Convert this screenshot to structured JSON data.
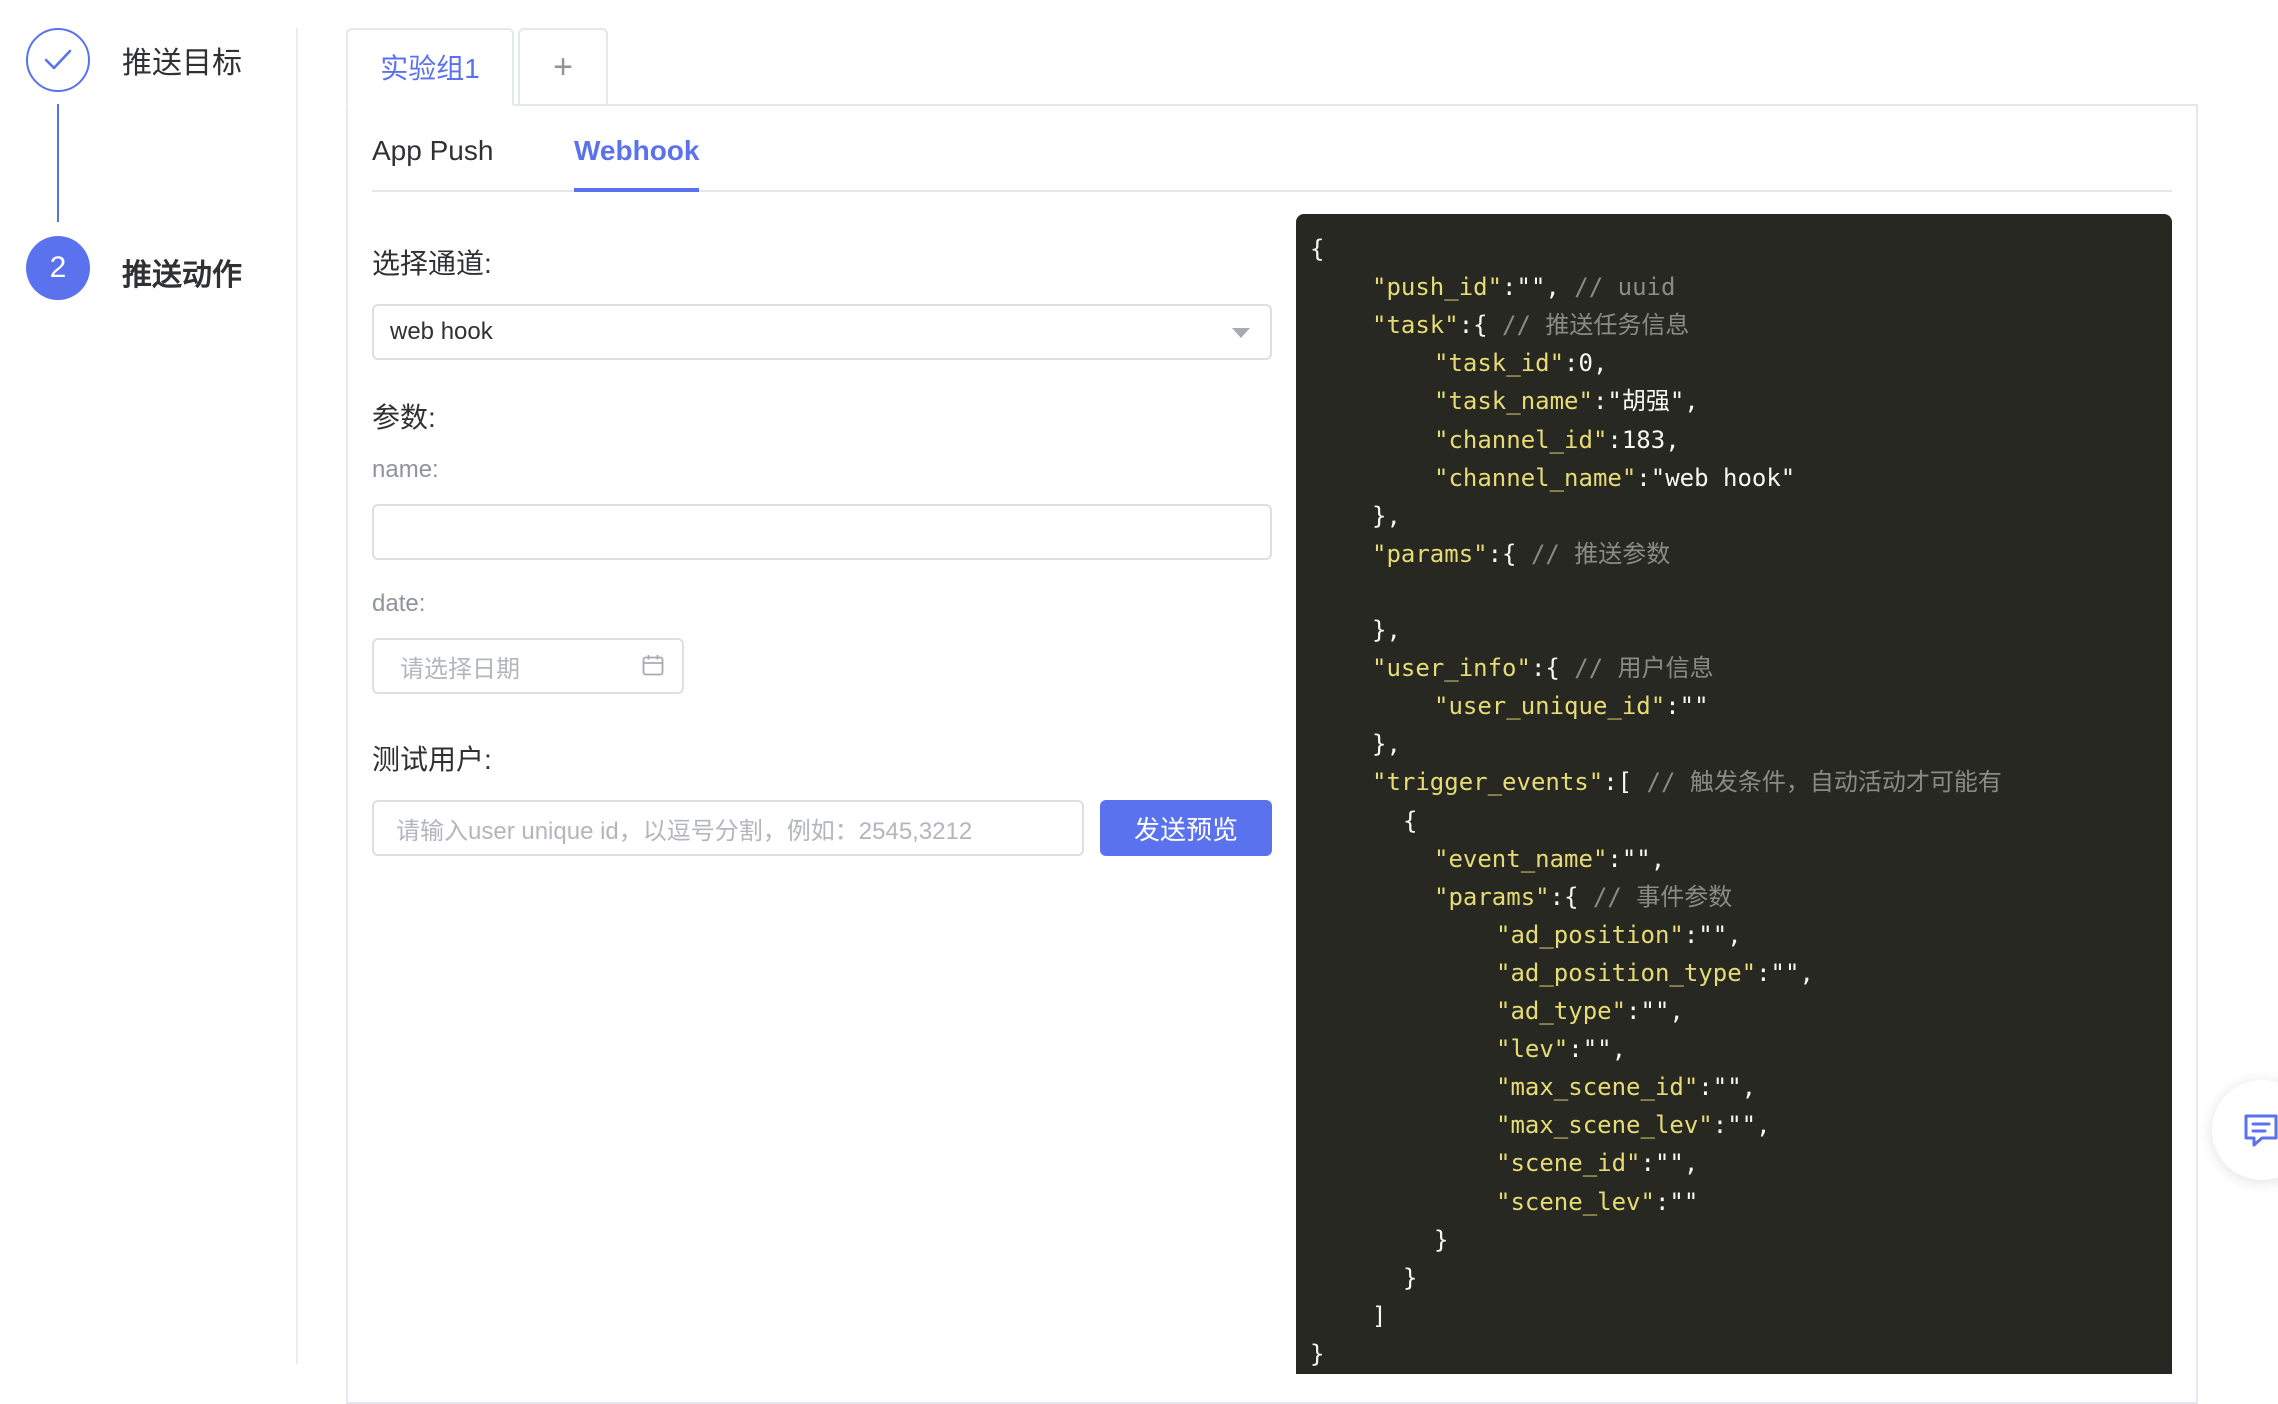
{
  "steps": [
    {
      "label": "推送目标",
      "status": "done"
    },
    {
      "number": "2",
      "label": "推送动作",
      "status": "active"
    }
  ],
  "group_tabs": [
    {
      "label": "实验组1",
      "active": true
    },
    {
      "label": "+",
      "active": false
    }
  ],
  "sub_tabs": [
    {
      "label": "App Push",
      "active": false
    },
    {
      "label": "Webhook",
      "active": true
    }
  ],
  "form": {
    "channel_label": "选择通道:",
    "channel_value": "web hook",
    "params_label": "参数:",
    "name_label": "name:",
    "name_value": "",
    "date_label": "date:",
    "date_placeholder": "请选择日期",
    "test_user_label": "测试用户:",
    "test_user_placeholder": "请输入user unique id，以逗号分割，例如：2545,3212",
    "send_button": "发送预览"
  },
  "code": {
    "lines": [
      {
        "indent": 0,
        "key": "",
        "value": "{",
        "comment": ""
      },
      {
        "indent": 1,
        "key": "\"push_id\"",
        "value": ":\"\",",
        "comment": " // uuid"
      },
      {
        "indent": 1,
        "key": "\"task\"",
        "value": ":{",
        "comment": " // 推送任务信息"
      },
      {
        "indent": 2,
        "key": "\"task_id\"",
        "value": ":0,",
        "comment": ""
      },
      {
        "indent": 2,
        "key": "\"task_name\"",
        "value": ":\"胡强\",",
        "comment": ""
      },
      {
        "indent": 2,
        "key": "\"channel_id\"",
        "value": ":183,",
        "comment": ""
      },
      {
        "indent": 2,
        "key": "\"channel_name\"",
        "value": ":\"web hook\"",
        "comment": ""
      },
      {
        "indent": 1,
        "key": "",
        "value": "},",
        "comment": ""
      },
      {
        "indent": 1,
        "key": "\"params\"",
        "value": ":{",
        "comment": " // 推送参数"
      },
      {
        "indent": 0,
        "key": "",
        "value": "",
        "comment": ""
      },
      {
        "indent": 1,
        "key": "",
        "value": "},",
        "comment": ""
      },
      {
        "indent": 1,
        "key": "\"user_info\"",
        "value": ":{",
        "comment": " // 用户信息"
      },
      {
        "indent": 2,
        "key": "\"user_unique_id\"",
        "value": ":\"\"",
        "comment": ""
      },
      {
        "indent": 1,
        "key": "",
        "value": "},",
        "comment": ""
      },
      {
        "indent": 1,
        "key": "\"trigger_events\"",
        "value": ":[",
        "comment": " // 触发条件，自动活动才可能有"
      },
      {
        "indent": 1.5,
        "key": "",
        "value": "{",
        "comment": ""
      },
      {
        "indent": 2,
        "key": "\"event_name\"",
        "value": ":\"\",",
        "comment": ""
      },
      {
        "indent": 2,
        "key": "\"params\"",
        "value": ":{",
        "comment": " // 事件参数"
      },
      {
        "indent": 3,
        "key": "\"ad_position\"",
        "value": ":\"\",",
        "comment": ""
      },
      {
        "indent": 3,
        "key": "\"ad_position_type\"",
        "value": ":\"\",",
        "comment": ""
      },
      {
        "indent": 3,
        "key": "\"ad_type\"",
        "value": ":\"\",",
        "comment": ""
      },
      {
        "indent": 3,
        "key": "\"lev\"",
        "value": ":\"\",",
        "comment": ""
      },
      {
        "indent": 3,
        "key": "\"max_scene_id\"",
        "value": ":\"\",",
        "comment": ""
      },
      {
        "indent": 3,
        "key": "\"max_scene_lev\"",
        "value": ":\"\",",
        "comment": ""
      },
      {
        "indent": 3,
        "key": "\"scene_id\"",
        "value": ":\"\",",
        "comment": ""
      },
      {
        "indent": 3,
        "key": "\"scene_lev\"",
        "value": ":\"\"",
        "comment": ""
      },
      {
        "indent": 2,
        "key": "",
        "value": "}",
        "comment": ""
      },
      {
        "indent": 1.5,
        "key": "",
        "value": "}",
        "comment": ""
      },
      {
        "indent": 1,
        "key": "",
        "value": "]",
        "comment": ""
      },
      {
        "indent": 0,
        "key": "",
        "value": "}",
        "comment": ""
      }
    ]
  },
  "icons": {
    "step1": "check-icon",
    "date": "calendar-icon",
    "select": "chevron-down-icon",
    "float": "feedback-icon"
  },
  "colors": {
    "accent": "#5b72ee",
    "code_bg": "#272822",
    "code_key": "#e6db74",
    "code_comment": "#8b8b85"
  }
}
